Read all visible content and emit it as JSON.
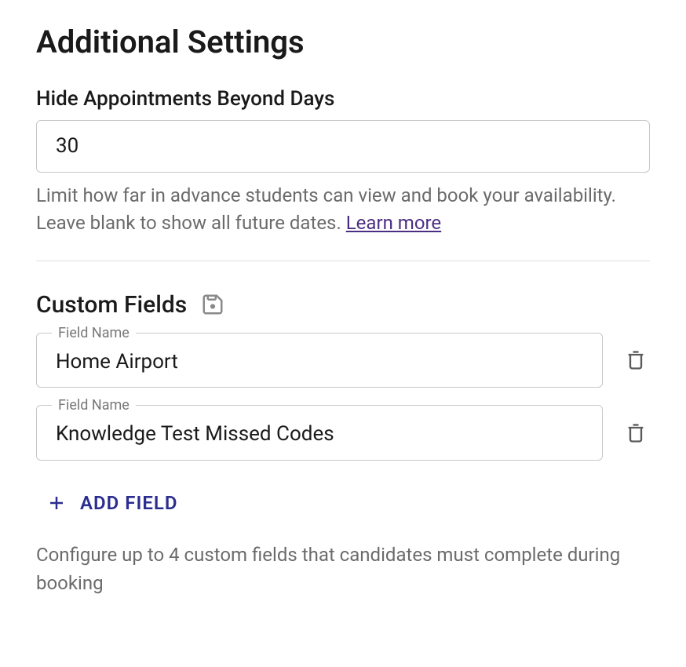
{
  "page_title": "Additional Settings",
  "hide_days": {
    "label": "Hide Appointments Beyond Days",
    "value": "30",
    "helper": "Limit how far in advance students can view and book your availability. Leave blank to show all future dates. ",
    "learn_more": "Learn more"
  },
  "custom_fields": {
    "title": "Custom Fields",
    "field_name_label": "Field Name",
    "items": [
      {
        "value": "Home Airport"
      },
      {
        "value": "Knowledge Test Missed Codes"
      }
    ],
    "add_label": "ADD FIELD",
    "caption": "Configure up to 4 custom fields that candidates must complete during booking"
  }
}
